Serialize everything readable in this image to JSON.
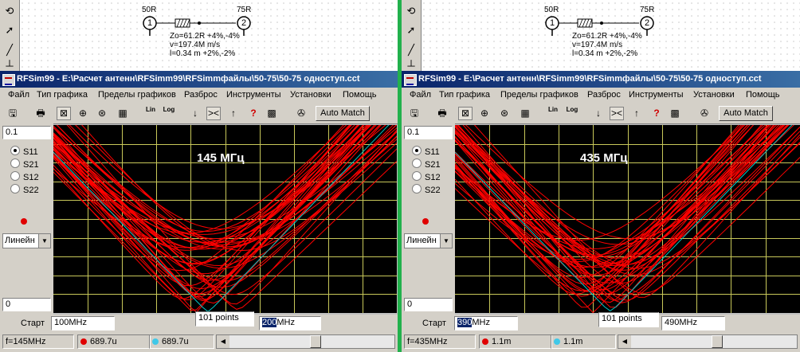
{
  "panels": [
    {
      "schematic": {
        "port1": {
          "label": "50R",
          "number": "1"
        },
        "port2": {
          "label": "75R",
          "number": "2"
        },
        "line": {
          "zo": "Zo=61.2R  +4%,-4%",
          "v": "v=197.4M m/s",
          "l": "l=0.34 m  +2%,-2%"
        }
      },
      "window": {
        "title": "RFSim99 - E:\\Расчет антенн\\RFSimm99\\RFSimmфайлы\\50-75\\50-75 одноступ.cct"
      },
      "menu": [
        "Файл",
        "Тип графика",
        "Пределы графиков",
        "Разброс",
        "Инструменты",
        "Установки",
        "Помощь"
      ],
      "toolbar": {
        "auto_match": "Auto Match",
        "lin": "Lin",
        "log": "Log"
      },
      "side": {
        "top_value": "0.1",
        "bottom_value": "0",
        "radios": [
          "S11",
          "S21",
          "S12",
          "S22"
        ],
        "selected": "S11",
        "scale": "Линейн"
      },
      "plot": {
        "label": "145 МГц"
      },
      "bottom": {
        "start_label": "Старт",
        "start_value": "100MHz",
        "points": "101 points",
        "stop_prefix": "200",
        "stop_suffix": "MHz"
      },
      "status": {
        "freq": "f=145MHz",
        "marker1": "689.7u",
        "marker2": "689.7u"
      },
      "chart_data": {
        "type": "line",
        "series_count": 40,
        "x_range": [
          "100MHz",
          "200MHz"
        ],
        "y_range": [
          0,
          0.1
        ],
        "y_scale": "linear",
        "grid": true,
        "minimum_x_fraction": 0.45,
        "nominal_minimum": 0.00069,
        "spread_minimum_range": [
          0.0,
          0.045
        ]
      }
    },
    {
      "schematic": {
        "port1": {
          "label": "50R",
          "number": "1"
        },
        "port2": {
          "label": "75R",
          "number": "2"
        },
        "line": {
          "zo": "Zo=61.2R  +4%,-4%",
          "v": "v=197.4M m/s",
          "l": "l=0.34 m  +2%,-2%"
        }
      },
      "window": {
        "title": "RFSim99 - E:\\Расчет антенн\\RFSimm99\\RFSimmфайлы\\50-75\\50-75 одноступ.cct"
      },
      "menu": [
        "Файл",
        "Тип графика",
        "Пределы графиков",
        "Разброс",
        "Инструменты",
        "Установки",
        "Помощь"
      ],
      "toolbar": {
        "auto_match": "Auto Match",
        "lin": "Lin",
        "log": "Log"
      },
      "side": {
        "top_value": "0.1",
        "bottom_value": "0",
        "radios": [
          "S11",
          "S21",
          "S12",
          "S22"
        ],
        "selected": "S11",
        "scale": "Линейн"
      },
      "plot": {
        "label": "435 МГц"
      },
      "bottom": {
        "start_label": "Старт",
        "start_prefix": "390",
        "start_suffix": "MHz",
        "points": "101 points",
        "stop_value": "490MHz"
      },
      "status": {
        "freq": "f=435MHz",
        "marker1": "1.1m",
        "marker2": "1.1m"
      },
      "chart_data": {
        "type": "line",
        "series_count": 40,
        "x_range": [
          "390MHz",
          "490MHz"
        ],
        "y_range": [
          0,
          0.1
        ],
        "y_scale": "linear",
        "grid": true,
        "minimum_x_fraction": 0.45,
        "nominal_minimum": 0.0011,
        "spread_minimum_range": [
          0.0,
          0.04
        ]
      }
    }
  ],
  "colors": {
    "trace": "#ff0000",
    "nominal_trace": "#00c8c8",
    "grid": "#c8c85a",
    "plot_bg": "#000000",
    "titlebar": "#0a246a",
    "divider": "#22b14c"
  }
}
